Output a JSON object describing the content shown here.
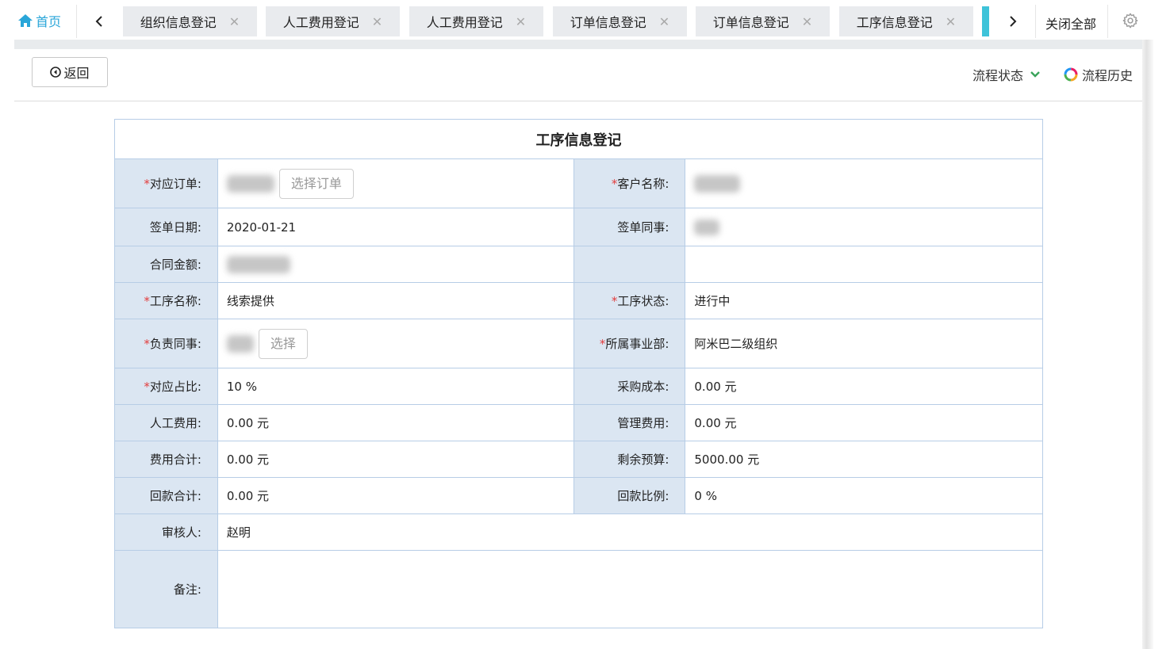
{
  "tabbar": {
    "home_label": "首页",
    "tabs": [
      {
        "label": "组织信息登记"
      },
      {
        "label": "人工费用登记"
      },
      {
        "label": "人工费用登记"
      },
      {
        "label": "订单信息登记"
      },
      {
        "label": "订单信息登记"
      },
      {
        "label": "工序信息登记"
      }
    ],
    "close_glyph": "✕",
    "close_all_label": "关闭全部",
    "accent_color": "#3ec3d9",
    "home_color": "#2aa6d9"
  },
  "toolbar": {
    "back_label": "返回",
    "flow_status_label": "流程状态",
    "flow_history_label": "流程历史"
  },
  "form": {
    "title": "工序信息登记",
    "rows": {
      "order_label": "对应订单:",
      "order_select_button": "选择订单",
      "customer_label": "客户名称:",
      "sign_date_label": "签单日期:",
      "sign_date_value": "2020-01-21",
      "sign_colleague_label": "签单同事:",
      "contract_amount_label": "合同金额:",
      "process_name_label": "工序名称:",
      "process_name_value": "线索提供",
      "process_status_label": "工序状态:",
      "process_status_value": "进行中",
      "owner_label": "负责同事:",
      "owner_select_button": "选择",
      "division_label": "所属事业部:",
      "division_value": "阿米巴二级组织",
      "ratio_label": "对应占比:",
      "ratio_value": "10 %",
      "purchase_cost_label": "采购成本:",
      "purchase_cost_value": "0.00 元",
      "labor_cost_label": "人工费用:",
      "labor_cost_value": "0.00 元",
      "management_cost_label": "管理费用:",
      "management_cost_value": "0.00 元",
      "total_cost_label": "费用合计:",
      "total_cost_value": "0.00 元",
      "remaining_budget_label": "剩余预算:",
      "remaining_budget_value": "5000.00 元",
      "payment_total_label": "回款合计:",
      "payment_total_value": "0.00 元",
      "payment_ratio_label": "回款比例:",
      "payment_ratio_value": "0 %",
      "reviewer_label": "审核人:",
      "reviewer_value": "赵明",
      "remark_label": "备注:",
      "remark_value": ""
    },
    "required_mark": "*",
    "required_color": "#e23d3d",
    "label_bg_color": "#dbe6f2",
    "border_color": "#b7cde6"
  }
}
